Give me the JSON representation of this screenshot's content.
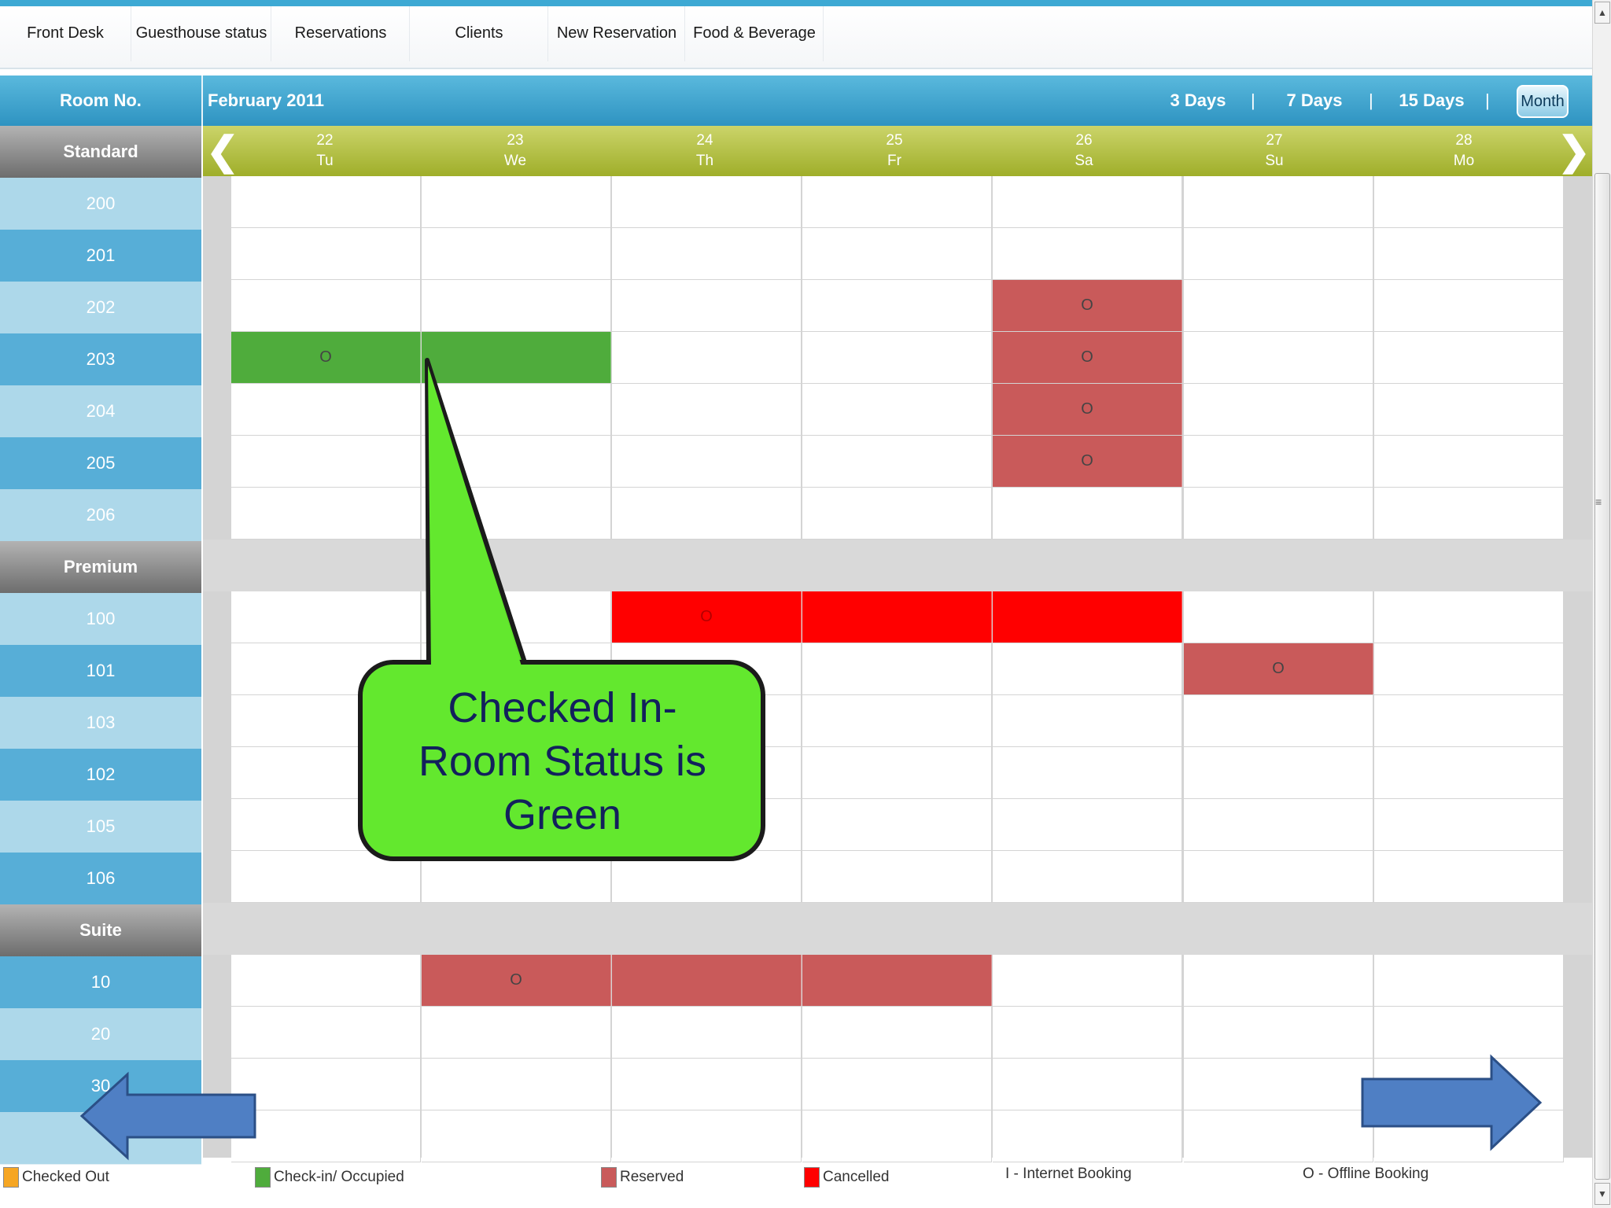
{
  "nav": {
    "tabs": [
      "Front Desk",
      "Guesthouse status",
      "Reservations",
      "Clients",
      "New Reservation",
      "Food & Beverage"
    ]
  },
  "header": {
    "room_label": "Room No.",
    "month_label": "February 2011",
    "views": [
      "3 Days",
      "7 Days",
      "15 Days",
      "Month"
    ],
    "separator": "|",
    "prev_glyph": "❮",
    "next_glyph": "❯"
  },
  "dates": [
    {
      "day": "22",
      "dow": "Tu"
    },
    {
      "day": "23",
      "dow": "We"
    },
    {
      "day": "24",
      "dow": "Th"
    },
    {
      "day": "25",
      "dow": "Fr"
    },
    {
      "day": "26",
      "dow": "Sa"
    },
    {
      "day": "27",
      "dow": "Su"
    },
    {
      "day": "28",
      "dow": "Mo"
    }
  ],
  "categories": [
    {
      "name": "Standard",
      "rooms": [
        "200",
        "201",
        "202",
        "203",
        "204",
        "205",
        "206"
      ]
    },
    {
      "name": "Premium",
      "rooms": [
        "100",
        "101",
        "103",
        "102",
        "105",
        "106"
      ]
    },
    {
      "name": "Suite",
      "rooms": [
        "10",
        "20",
        "30",
        ""
      ]
    }
  ],
  "bookings": [
    {
      "room": "203",
      "start": 0,
      "span": 2,
      "status": "check-in",
      "code": "O"
    },
    {
      "room": "202",
      "start": 4,
      "span": 1,
      "status": "reserved",
      "code": "O"
    },
    {
      "room": "203",
      "start": 4,
      "span": 1,
      "status": "reserved",
      "code": "O"
    },
    {
      "room": "204",
      "start": 4,
      "span": 1,
      "status": "reserved",
      "code": "O"
    },
    {
      "room": "205",
      "start": 4,
      "span": 1,
      "status": "reserved",
      "code": "O"
    },
    {
      "room": "100",
      "start": 2,
      "span": 3,
      "status": "cancelled",
      "code": "O"
    },
    {
      "room": "101",
      "start": 5,
      "span": 1,
      "status": "reserved",
      "code": "O"
    },
    {
      "room": "10",
      "start": 1,
      "span": 3,
      "status": "reserved",
      "code": "O"
    }
  ],
  "callout": {
    "lines": [
      "Checked In-",
      "Room Status is",
      "Green"
    ]
  },
  "legend": {
    "checked_out": "Checked Out",
    "check_in": "Check-in/ Occupied",
    "reserved": "Reserved",
    "cancelled": "Cancelled",
    "internet": "I - Internet Booking",
    "offline": "O - Offline Booking"
  },
  "colors": {
    "checked_out": "#f6a623",
    "check_in": "#4fac3c",
    "reserved": "#c95a5a",
    "cancelled": "#ff0000",
    "header_blue": "#2e93c1",
    "date_green": "#a9b733",
    "callout_green": "#63e82e",
    "arrow_blue": "#4f7fc4"
  }
}
